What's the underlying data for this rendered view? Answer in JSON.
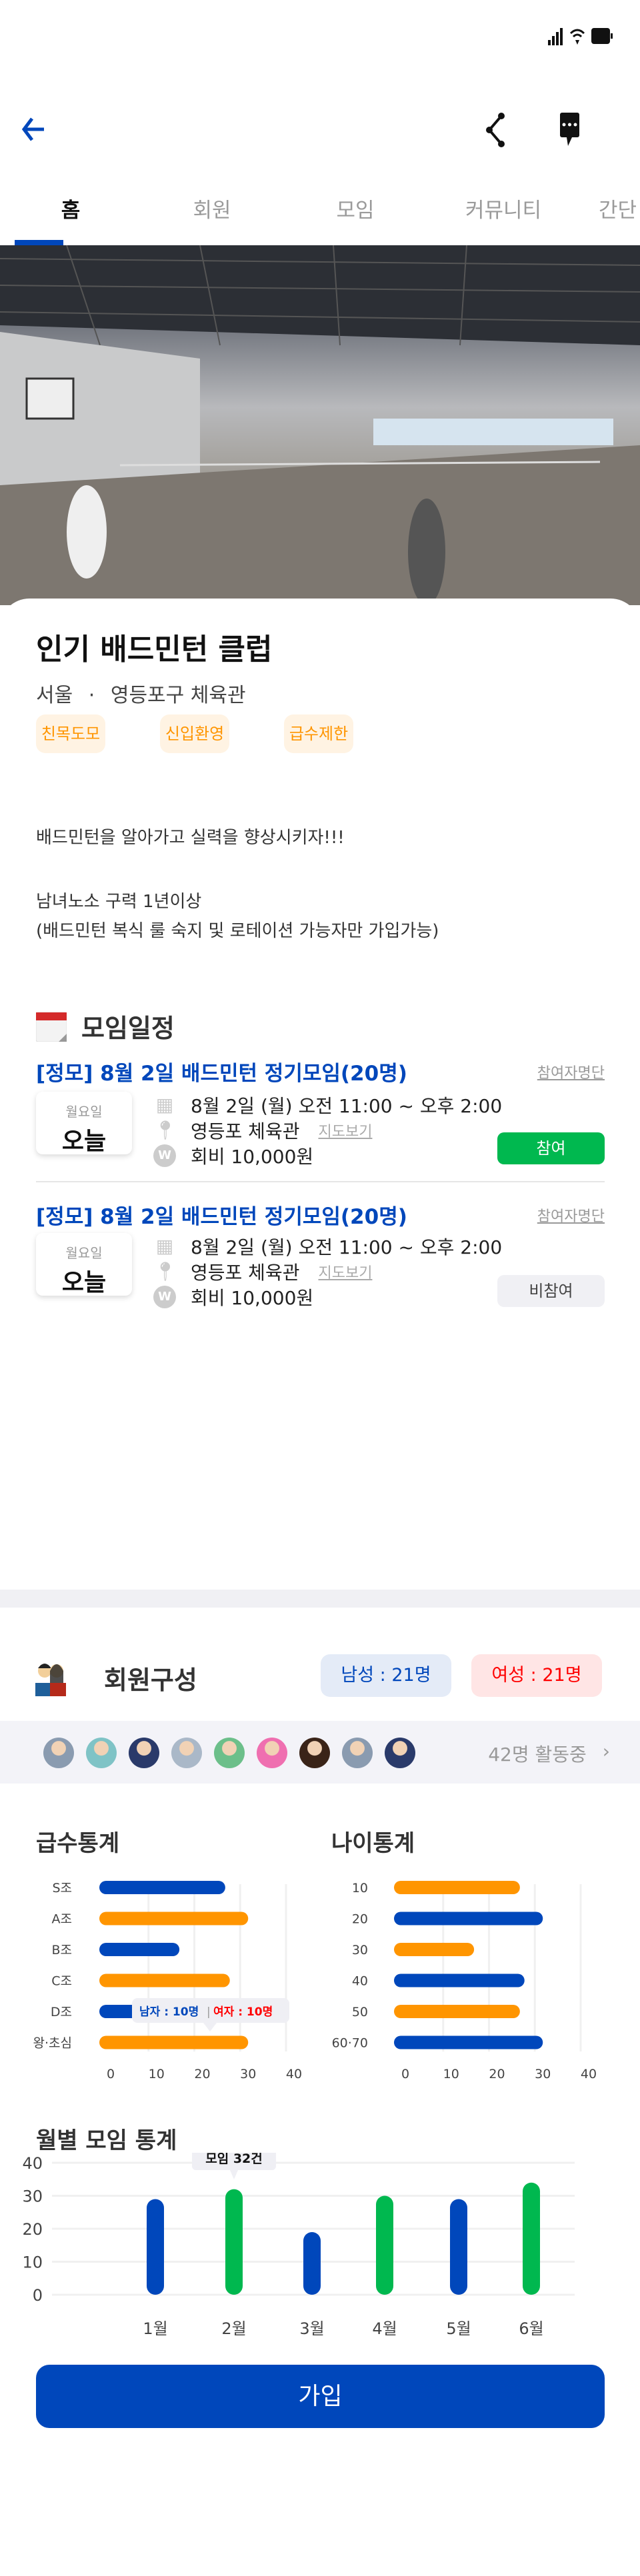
{
  "status_bar": {
    "icons": [
      "signal-icon",
      "wifi-icon",
      "battery-icon"
    ]
  },
  "header": {
    "back_icon": "arrow-left-icon",
    "share_icon": "share-icon",
    "chat_icon": "chat-bubble-icon"
  },
  "tabs": [
    {
      "label": "홈",
      "active": true
    },
    {
      "label": "회원",
      "active": false
    },
    {
      "label": "모임",
      "active": false
    },
    {
      "label": "커뮤니티",
      "active": false
    },
    {
      "label": "간단",
      "active": false
    }
  ],
  "club": {
    "title": "인기 배드민턴 클럽",
    "region": "서울",
    "separator": "·",
    "venue": "영등포구 체육관",
    "tags": [
      "친목도모",
      "신입환영",
      "급수제한"
    ],
    "description": [
      "배드민턴을 알아가고 실력을 향상시키자!!!",
      "남녀노소 구력 1년이상",
      "(배드민턴 복식 룰 숙지 및 로테이션 가능자만 가입가능)"
    ]
  },
  "schedule": {
    "title": "모임일정",
    "events": [
      {
        "title": "[정모] 8월 2일 배드민턴 정기모임(20명)",
        "participants_link": "참여자명단",
        "weekday": "월요일",
        "day": "오늘",
        "datetime": "8월 2일 (월) 오전 11:00 ~ 오후 2:00",
        "place": "영등포 체육관",
        "map_link": "지도보기",
        "fee": "회비 10,000원",
        "button": "참여",
        "button_state": "join"
      },
      {
        "title": "[정모] 8월 2일 배드민턴 정기모임(20명)",
        "participants_link": "참여자명단",
        "weekday": "월요일",
        "day": "오늘",
        "datetime": "8월 2일 (월) 오전 11:00 ~ 오후 2:00",
        "place": "영등포 체육관",
        "map_link": "지도보기",
        "fee": "회비 10,000원",
        "button": "비참여",
        "button_state": "not-join"
      }
    ]
  },
  "members": {
    "title": "회원구성",
    "male_badge": "남성 : 21명",
    "female_badge": "여성 : 21명",
    "avatar_count": 9,
    "active_text": "42명 활동중"
  },
  "colors": {
    "primary": "#0047BB",
    "orange": "#FF9500",
    "green": "#00B84F",
    "female": "#FF0000"
  },
  "chart_data": [
    {
      "type": "bar",
      "orientation": "horizontal",
      "title": "급수통계",
      "categories": [
        "S조",
        "A조",
        "B조",
        "C조",
        "D조",
        "왕·초심"
      ],
      "values": [
        25,
        30,
        15,
        26,
        20,
        30
      ],
      "bar_colors": [
        "#0047BB",
        "#FF9500",
        "#0047BB",
        "#FF9500",
        "#0047BB",
        "#FF9500"
      ],
      "xlim": [
        0,
        40
      ],
      "ticks": [
        "0",
        "10",
        "20",
        "30",
        "40"
      ],
      "grid": true,
      "tooltip": {
        "category": "D조",
        "male": "남자 : 10명",
        "divider": "|",
        "female": "여자 : 10명"
      }
    },
    {
      "type": "bar",
      "orientation": "horizontal",
      "title": "나이통계",
      "categories": [
        "10",
        "20",
        "30",
        "40",
        "50",
        "60·70"
      ],
      "values": [
        25,
        30,
        15,
        26,
        25,
        30
      ],
      "bar_colors": [
        "#FF9500",
        "#0047BB",
        "#FF9500",
        "#0047BB",
        "#FF9500",
        "#0047BB"
      ],
      "xlim": [
        0,
        40
      ],
      "ticks": [
        "0",
        "10",
        "20",
        "30",
        "40"
      ],
      "grid": true
    },
    {
      "type": "bar",
      "orientation": "vertical",
      "title": "월별 모임 통계",
      "categories": [
        "1월",
        "2월",
        "3월",
        "4월",
        "5월",
        "6월"
      ],
      "values": [
        29,
        32,
        19,
        30,
        29,
        34
      ],
      "bar_colors": [
        "#0047BB",
        "#00B84F",
        "#0047BB",
        "#00B84F",
        "#0047BB",
        "#00B84F"
      ],
      "ylim": [
        0,
        40
      ],
      "ticks": [
        "0",
        "10",
        "20",
        "30",
        "40"
      ],
      "grid": true,
      "tooltip": {
        "category": "2월",
        "text": "모임 32건"
      }
    }
  ],
  "footer": {
    "join_button": "가입"
  }
}
